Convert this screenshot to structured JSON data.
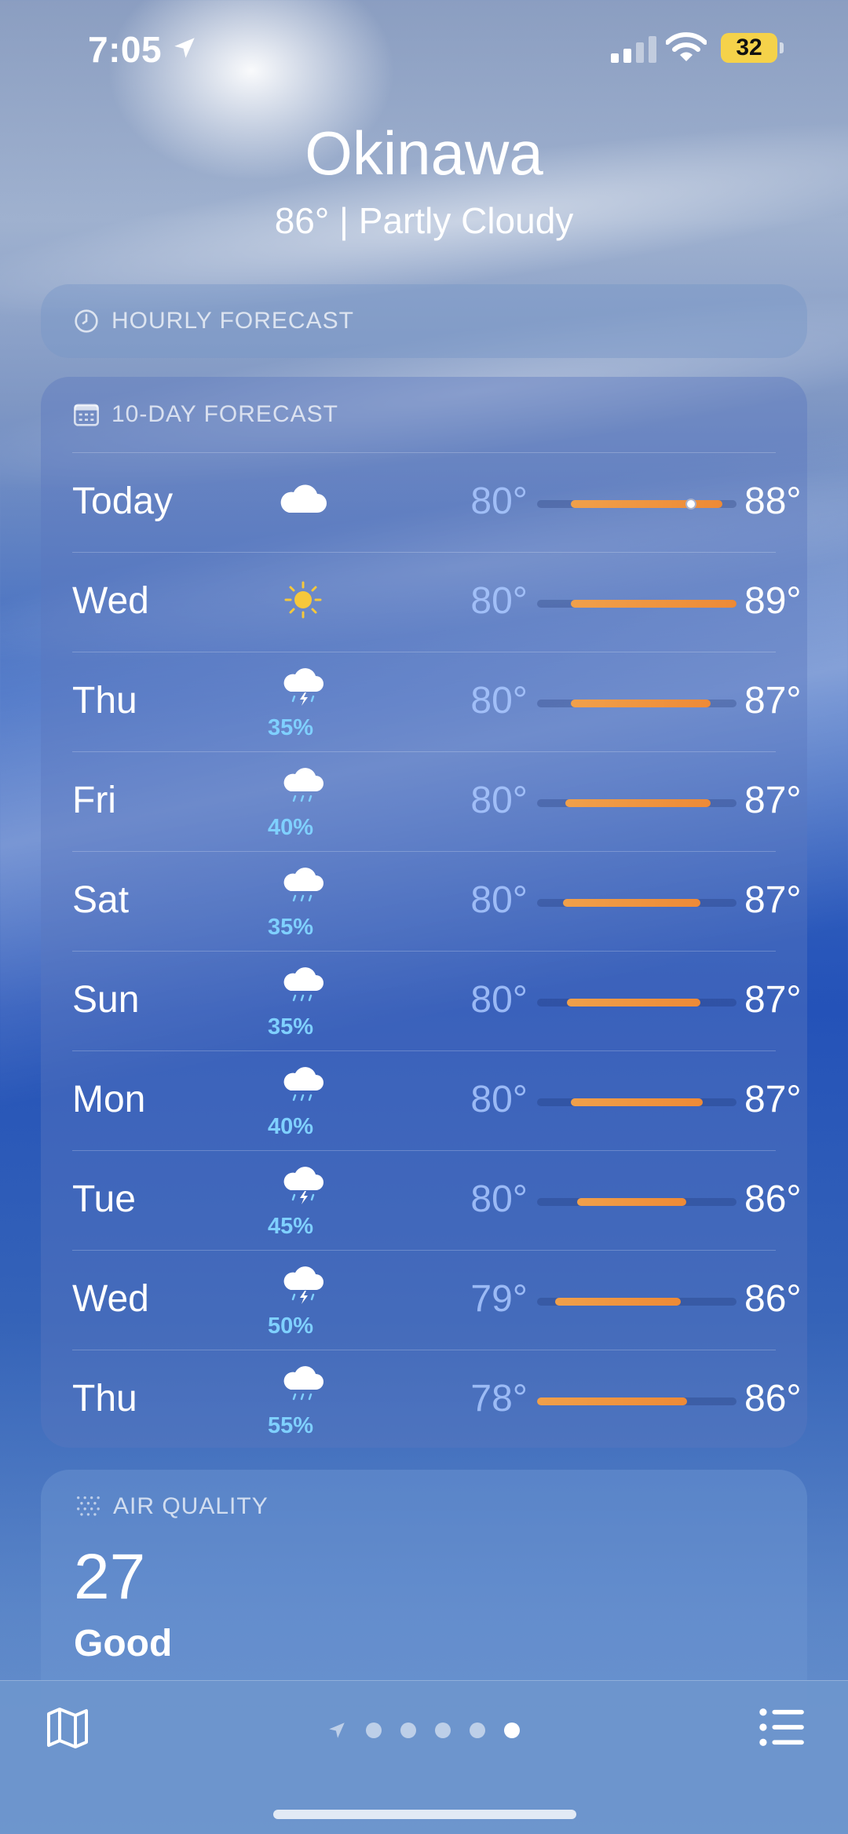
{
  "status_bar": {
    "time": "7:05",
    "battery": "32"
  },
  "location": {
    "city": "Okinawa",
    "summary": "86°  |  Partly Cloudy"
  },
  "hourly_forecast": {
    "title": "HOURLY FORECAST",
    "icon": "clock-icon"
  },
  "ten_day": {
    "title": "10-DAY FORECAST",
    "icon": "calendar-icon",
    "days": [
      {
        "day": "Today",
        "icon": "cloud-icon",
        "precip": "",
        "low": "80°",
        "high": "88°",
        "range_start": 0.17,
        "range_end": 0.93,
        "current": 0.77
      },
      {
        "day": "Wed",
        "icon": "sun-icon",
        "precip": "",
        "low": "80°",
        "high": "89°",
        "range_start": 0.17,
        "range_end": 1.0
      },
      {
        "day": "Thu",
        "icon": "thunderstorm-icon",
        "precip": "35%",
        "low": "80°",
        "high": "87°",
        "range_start": 0.17,
        "range_end": 0.87
      },
      {
        "day": "Fri",
        "icon": "rain-icon",
        "precip": "40%",
        "low": "80°",
        "high": "87°",
        "range_start": 0.14,
        "range_end": 0.87
      },
      {
        "day": "Sat",
        "icon": "rain-icon",
        "precip": "35%",
        "low": "80°",
        "high": "87°",
        "range_start": 0.13,
        "range_end": 0.82
      },
      {
        "day": "Sun",
        "icon": "rain-icon",
        "precip": "35%",
        "low": "80°",
        "high": "87°",
        "range_start": 0.15,
        "range_end": 0.82
      },
      {
        "day": "Mon",
        "icon": "rain-icon",
        "precip": "40%",
        "low": "80°",
        "high": "87°",
        "range_start": 0.17,
        "range_end": 0.83
      },
      {
        "day": "Tue",
        "icon": "thunderstorm-icon",
        "precip": "45%",
        "low": "80°",
        "high": "86°",
        "range_start": 0.2,
        "range_end": 0.75
      },
      {
        "day": "Wed",
        "icon": "thunderstorm-icon",
        "precip": "50%",
        "low": "79°",
        "high": "86°",
        "range_start": 0.09,
        "range_end": 0.72
      },
      {
        "day": "Thu",
        "icon": "rain-icon",
        "precip": "55%",
        "low": "78°",
        "high": "86°",
        "range_start": 0.0,
        "range_end": 0.75
      }
    ]
  },
  "air_quality": {
    "title": "AIR QUALITY",
    "icon": "air-quality-icon",
    "value": "27",
    "label": "Good"
  },
  "colors": {
    "range_fill": "#ee8a36",
    "precip": "#7fd0ff",
    "sun": "#f6c83b",
    "battery": "#f5d24a"
  },
  "bottom_bar": {
    "pages": 5,
    "active_page": 4
  }
}
